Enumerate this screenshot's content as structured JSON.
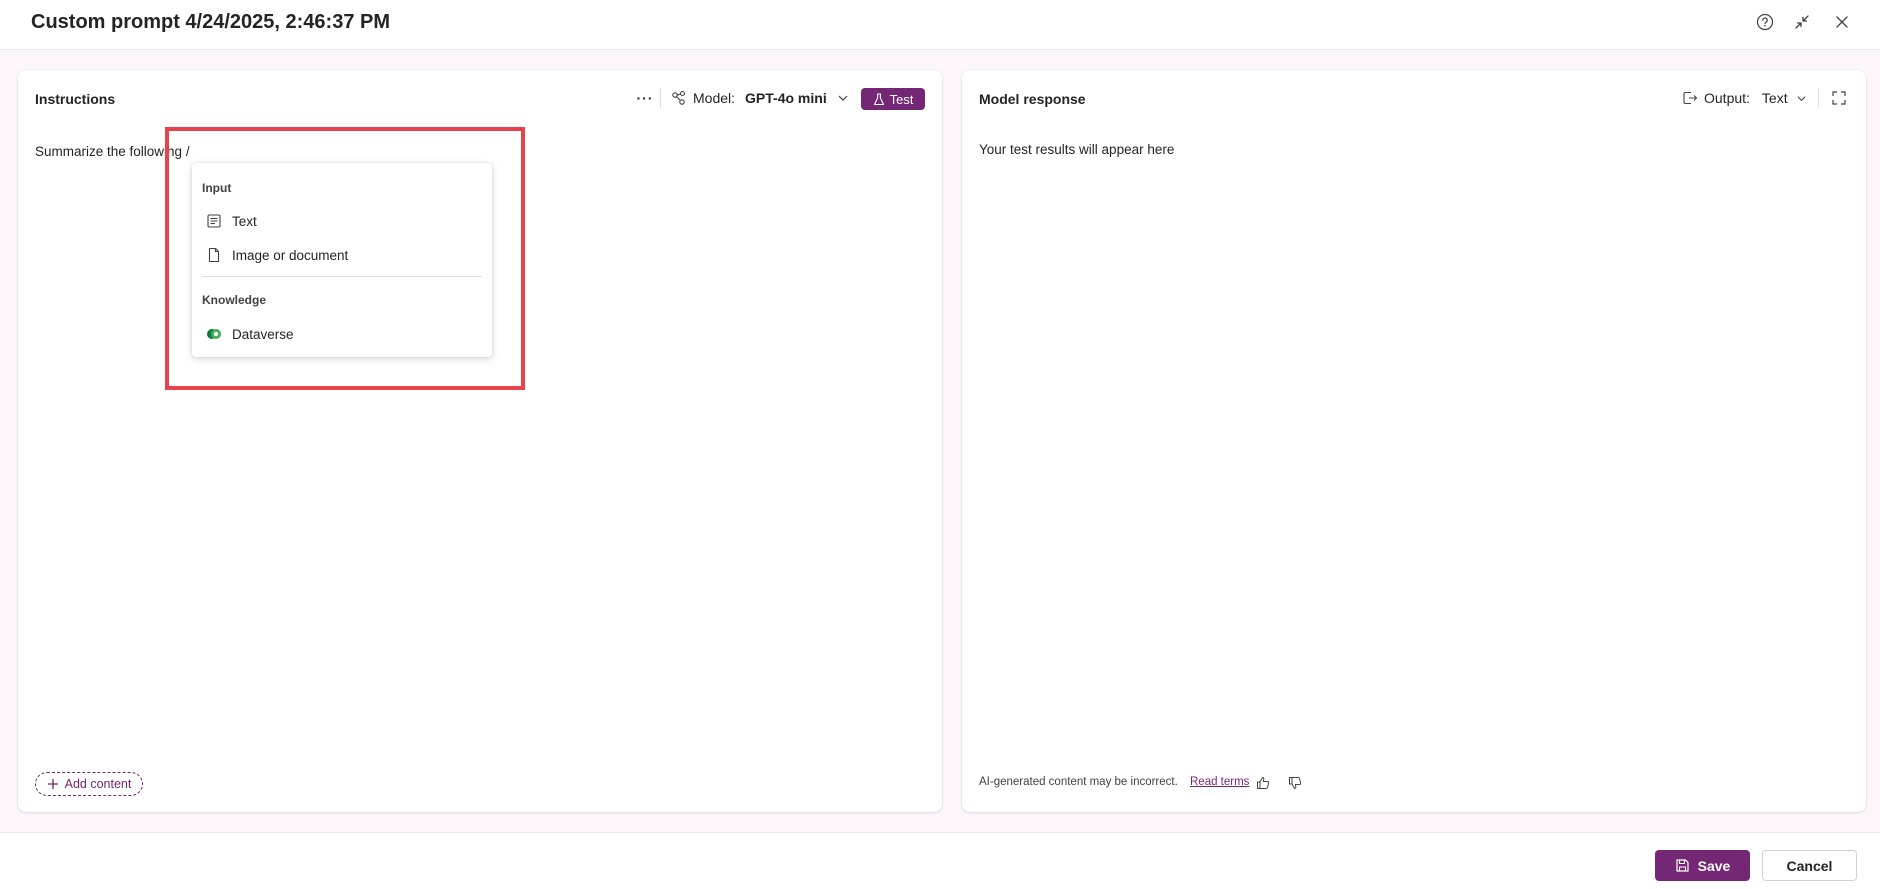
{
  "window": {
    "title": "Custom prompt 4/24/2025, 2:46:37 PM",
    "icons": [
      "help-icon",
      "collapse-icon",
      "close-icon"
    ]
  },
  "instructions": {
    "title": "Instructions",
    "more_label": "···",
    "model_label": "Model:",
    "model_value": "GPT-4o mini",
    "test_label": "Test",
    "editor_text": "Summarize the following /",
    "add_content_label": "Add content"
  },
  "menu": {
    "input_header": "Input",
    "items_input": [
      {
        "label": "Text",
        "icon": "text-doc-icon"
      },
      {
        "label": "Image or document",
        "icon": "document-icon"
      }
    ],
    "knowledge_header": "Knowledge",
    "items_knowledge": [
      {
        "label": "Dataverse",
        "icon": "dataverse-icon"
      }
    ]
  },
  "response": {
    "title": "Model response",
    "output_label": "Output:",
    "output_value": "Text",
    "placeholder": "Your test results will appear here",
    "disclaimer": "AI-generated content may be incorrect.",
    "read_terms": "Read terms"
  },
  "footer": {
    "save_label": "Save",
    "cancel_label": "Cancel"
  },
  "colors": {
    "accent": "#742774",
    "highlight": "#e8424b",
    "background": "#fdf7fc"
  }
}
